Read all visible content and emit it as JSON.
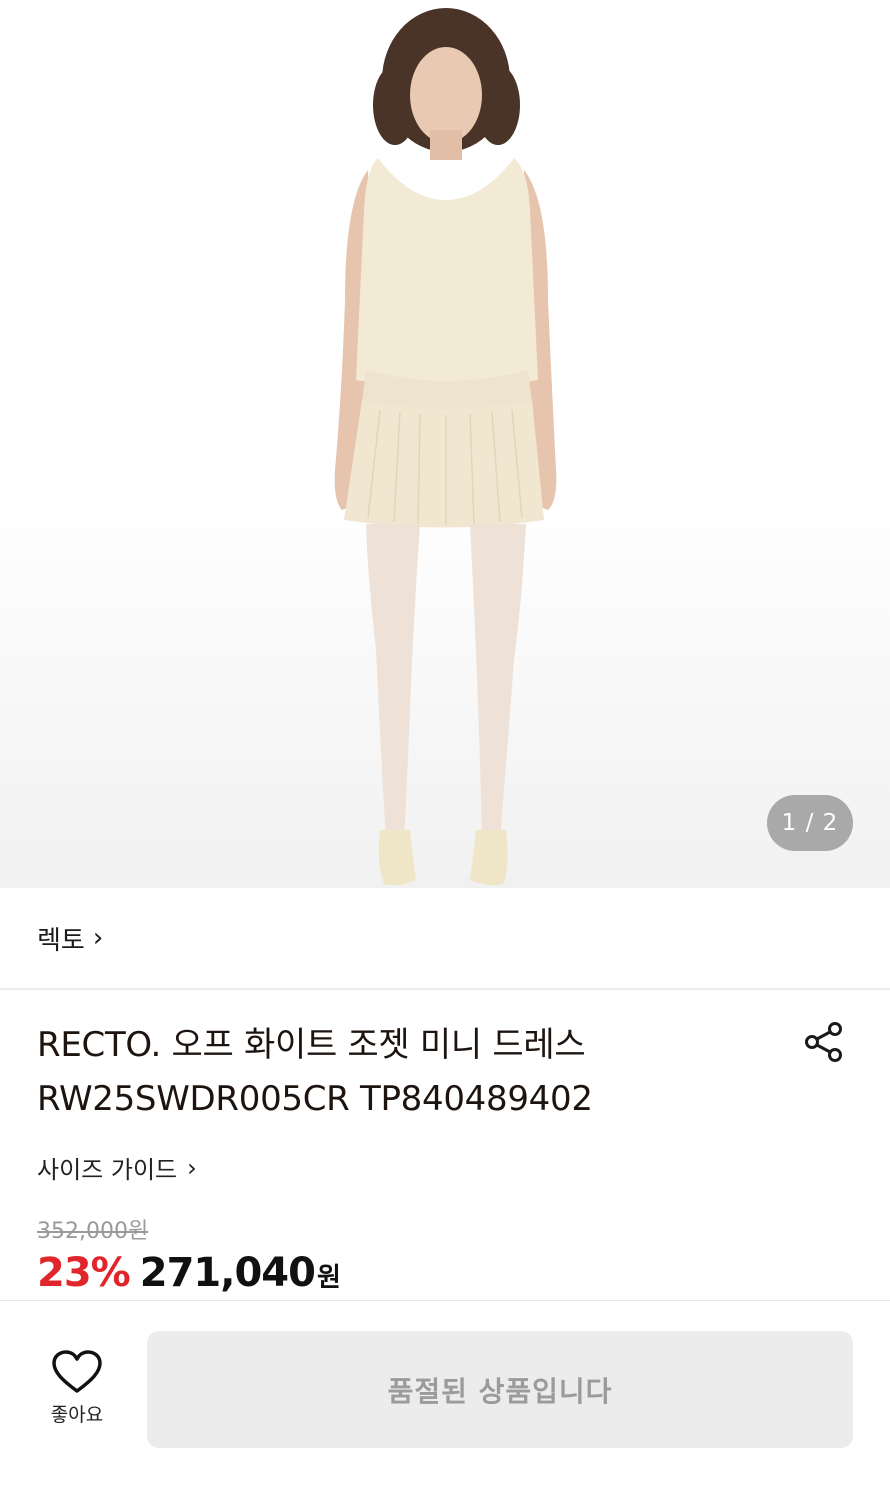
{
  "gallery": {
    "image_alt": "product-model-photo",
    "counter": "1 / 2"
  },
  "brand": {
    "name": "렉토",
    "chevron": "›"
  },
  "product": {
    "title_line1": "RECTO. 오프 화이트 조젯 미니 드레스",
    "title_line2": "RW25SWDR005CR TP840489402",
    "share_icon": "share-icon"
  },
  "size_guide": {
    "label": "사이즈 가이드",
    "chevron": "›"
  },
  "pricing": {
    "original": "352,000원",
    "discount": "23%",
    "price": "271,040",
    "currency": "원"
  },
  "bottom": {
    "like_label": "좋아요",
    "like_icon": "heart-icon",
    "soldout_label": "품절된 상품입니다"
  },
  "colors": {
    "discount": "#e1262b",
    "button_bg": "#ececec",
    "button_text": "#9b9b9b"
  }
}
